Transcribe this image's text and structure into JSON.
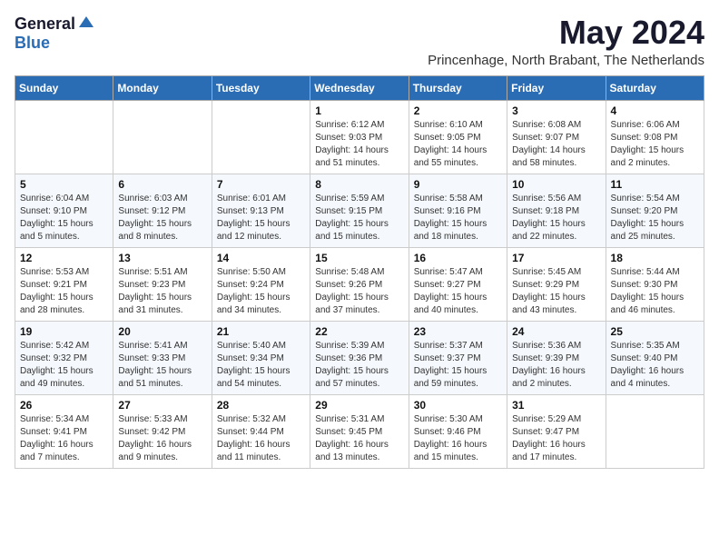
{
  "logo": {
    "general": "General",
    "blue": "Blue"
  },
  "title": "May 2024",
  "location": "Princenhage, North Brabant, The Netherlands",
  "headers": [
    "Sunday",
    "Monday",
    "Tuesday",
    "Wednesday",
    "Thursday",
    "Friday",
    "Saturday"
  ],
  "weeks": [
    [
      {
        "day": "",
        "info": ""
      },
      {
        "day": "",
        "info": ""
      },
      {
        "day": "",
        "info": ""
      },
      {
        "day": "1",
        "info": "Sunrise: 6:12 AM\nSunset: 9:03 PM\nDaylight: 14 hours\nand 51 minutes."
      },
      {
        "day": "2",
        "info": "Sunrise: 6:10 AM\nSunset: 9:05 PM\nDaylight: 14 hours\nand 55 minutes."
      },
      {
        "day": "3",
        "info": "Sunrise: 6:08 AM\nSunset: 9:07 PM\nDaylight: 14 hours\nand 58 minutes."
      },
      {
        "day": "4",
        "info": "Sunrise: 6:06 AM\nSunset: 9:08 PM\nDaylight: 15 hours\nand 2 minutes."
      }
    ],
    [
      {
        "day": "5",
        "info": "Sunrise: 6:04 AM\nSunset: 9:10 PM\nDaylight: 15 hours\nand 5 minutes."
      },
      {
        "day": "6",
        "info": "Sunrise: 6:03 AM\nSunset: 9:12 PM\nDaylight: 15 hours\nand 8 minutes."
      },
      {
        "day": "7",
        "info": "Sunrise: 6:01 AM\nSunset: 9:13 PM\nDaylight: 15 hours\nand 12 minutes."
      },
      {
        "day": "8",
        "info": "Sunrise: 5:59 AM\nSunset: 9:15 PM\nDaylight: 15 hours\nand 15 minutes."
      },
      {
        "day": "9",
        "info": "Sunrise: 5:58 AM\nSunset: 9:16 PM\nDaylight: 15 hours\nand 18 minutes."
      },
      {
        "day": "10",
        "info": "Sunrise: 5:56 AM\nSunset: 9:18 PM\nDaylight: 15 hours\nand 22 minutes."
      },
      {
        "day": "11",
        "info": "Sunrise: 5:54 AM\nSunset: 9:20 PM\nDaylight: 15 hours\nand 25 minutes."
      }
    ],
    [
      {
        "day": "12",
        "info": "Sunrise: 5:53 AM\nSunset: 9:21 PM\nDaylight: 15 hours\nand 28 minutes."
      },
      {
        "day": "13",
        "info": "Sunrise: 5:51 AM\nSunset: 9:23 PM\nDaylight: 15 hours\nand 31 minutes."
      },
      {
        "day": "14",
        "info": "Sunrise: 5:50 AM\nSunset: 9:24 PM\nDaylight: 15 hours\nand 34 minutes."
      },
      {
        "day": "15",
        "info": "Sunrise: 5:48 AM\nSunset: 9:26 PM\nDaylight: 15 hours\nand 37 minutes."
      },
      {
        "day": "16",
        "info": "Sunrise: 5:47 AM\nSunset: 9:27 PM\nDaylight: 15 hours\nand 40 minutes."
      },
      {
        "day": "17",
        "info": "Sunrise: 5:45 AM\nSunset: 9:29 PM\nDaylight: 15 hours\nand 43 minutes."
      },
      {
        "day": "18",
        "info": "Sunrise: 5:44 AM\nSunset: 9:30 PM\nDaylight: 15 hours\nand 46 minutes."
      }
    ],
    [
      {
        "day": "19",
        "info": "Sunrise: 5:42 AM\nSunset: 9:32 PM\nDaylight: 15 hours\nand 49 minutes."
      },
      {
        "day": "20",
        "info": "Sunrise: 5:41 AM\nSunset: 9:33 PM\nDaylight: 15 hours\nand 51 minutes."
      },
      {
        "day": "21",
        "info": "Sunrise: 5:40 AM\nSunset: 9:34 PM\nDaylight: 15 hours\nand 54 minutes."
      },
      {
        "day": "22",
        "info": "Sunrise: 5:39 AM\nSunset: 9:36 PM\nDaylight: 15 hours\nand 57 minutes."
      },
      {
        "day": "23",
        "info": "Sunrise: 5:37 AM\nSunset: 9:37 PM\nDaylight: 15 hours\nand 59 minutes."
      },
      {
        "day": "24",
        "info": "Sunrise: 5:36 AM\nSunset: 9:39 PM\nDaylight: 16 hours\nand 2 minutes."
      },
      {
        "day": "25",
        "info": "Sunrise: 5:35 AM\nSunset: 9:40 PM\nDaylight: 16 hours\nand 4 minutes."
      }
    ],
    [
      {
        "day": "26",
        "info": "Sunrise: 5:34 AM\nSunset: 9:41 PM\nDaylight: 16 hours\nand 7 minutes."
      },
      {
        "day": "27",
        "info": "Sunrise: 5:33 AM\nSunset: 9:42 PM\nDaylight: 16 hours\nand 9 minutes."
      },
      {
        "day": "28",
        "info": "Sunrise: 5:32 AM\nSunset: 9:44 PM\nDaylight: 16 hours\nand 11 minutes."
      },
      {
        "day": "29",
        "info": "Sunrise: 5:31 AM\nSunset: 9:45 PM\nDaylight: 16 hours\nand 13 minutes."
      },
      {
        "day": "30",
        "info": "Sunrise: 5:30 AM\nSunset: 9:46 PM\nDaylight: 16 hours\nand 15 minutes."
      },
      {
        "day": "31",
        "info": "Sunrise: 5:29 AM\nSunset: 9:47 PM\nDaylight: 16 hours\nand 17 minutes."
      },
      {
        "day": "",
        "info": ""
      }
    ]
  ]
}
